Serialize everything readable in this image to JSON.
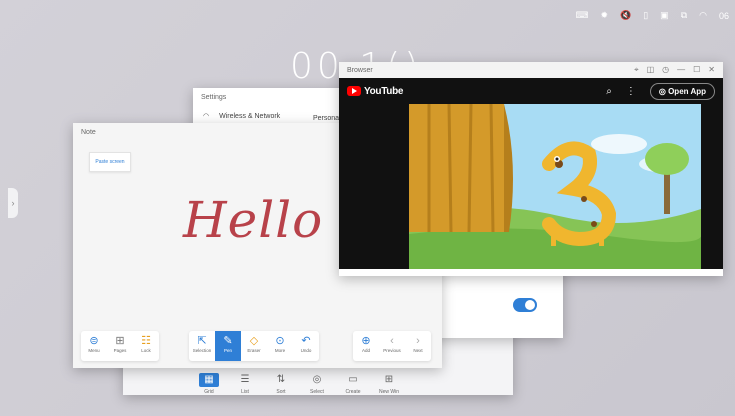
{
  "status_bar": {
    "icons": [
      "keyboard-icon",
      "brightness-icon",
      "mute-icon",
      "usb-icon",
      "screen-icon",
      "network-icon",
      "wifi-icon"
    ],
    "time": "06"
  },
  "clock": "00 1() ···",
  "files_window": {
    "buttons": [
      {
        "label": "Grid",
        "icon": "grid-icon",
        "active": true
      },
      {
        "label": "List",
        "icon": "list-icon",
        "active": false
      },
      {
        "label": "Sort",
        "icon": "sort-icon",
        "active": false
      },
      {
        "label": "Select",
        "icon": "select-icon",
        "active": false
      },
      {
        "label": "Create",
        "icon": "folder-icon",
        "active": false
      },
      {
        "label": "New Win",
        "icon": "new-window-icon",
        "active": false
      }
    ]
  },
  "settings_window": {
    "title": "Settings",
    "left_item": "Wireless & Network",
    "right_item": "Persona"
  },
  "note_window": {
    "title": "Note",
    "paste_label": "Paste screen",
    "content_text": "Hello",
    "toolbar_left": [
      "Menu",
      "Pages",
      "Lock"
    ],
    "toolbar_middle": [
      "Selection",
      "Pen",
      "Eraser",
      "More",
      "Undo"
    ],
    "toolbar_right": [
      "Add",
      "Previous",
      "Next"
    ]
  },
  "browser_window": {
    "title": "Browser",
    "brand": "YouTube",
    "open_app_label": "Open App"
  },
  "colors": {
    "accent": "#2f7fd6",
    "youtube_red": "#ff0000",
    "ink": "#b8424a"
  }
}
